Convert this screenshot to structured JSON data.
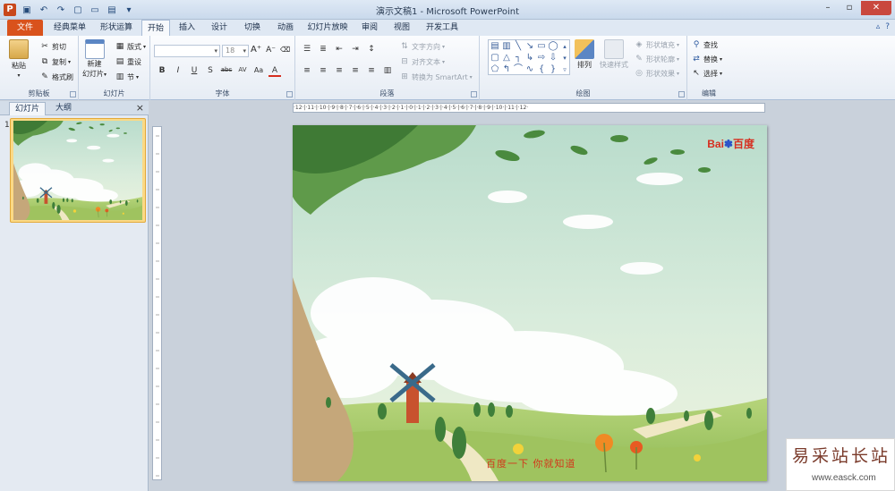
{
  "titlebar": {
    "app_icon": "P",
    "title": "演示文稿1 - Microsoft PowerPoint",
    "qat_icons": [
      "save-icon",
      "undo-icon",
      "redo-icon",
      "new-icon",
      "open-icon",
      "print-icon",
      "more-icon"
    ]
  },
  "tabs": [
    "文件",
    "经典菜单",
    "形状运算",
    "开始",
    "插入",
    "设计",
    "切换",
    "动画",
    "幻灯片放映",
    "审阅",
    "视图",
    "开发工具"
  ],
  "active_tab": "开始",
  "ribbon": {
    "clipboard": {
      "label": "剪贴板",
      "paste": "粘贴",
      "cut": "剪切",
      "copy": "复制",
      "painter": "格式刷"
    },
    "slides": {
      "label": "幻灯片",
      "new_slide_1": "新建",
      "new_slide_2": "幻灯片",
      "layout": "版式",
      "reset": "重设",
      "section": "节"
    },
    "font": {
      "label": "字体",
      "size": "18",
      "bold": "B",
      "italic": "I",
      "underline": "U",
      "shadow": "S",
      "strike": "abc",
      "spacing": "AV",
      "case": "Aa",
      "color": "A"
    },
    "paragraph": {
      "label": "段落",
      "text_direction": "文字方向",
      "align_text": "对齐文本",
      "smartart": "转换为 SmartArt"
    },
    "drawing": {
      "label": "绘图",
      "arrange": "排列",
      "quick_styles": "快速样式",
      "shape_fill": "形状填充",
      "shape_outline": "形状轮廓",
      "shape_effects": "形状效果"
    },
    "editing": {
      "label": "编辑",
      "find": "查找",
      "replace": "替换",
      "select": "选择"
    }
  },
  "leftpanel": {
    "tab_slides": "幻灯片",
    "tab_outline": "大纲",
    "close": "×",
    "slide_number": "1"
  },
  "ruler_text": "·12·|·11·|·10·|·9·|·8·|·7·|·6·|·5·|·4·|·3·|·2·|·1·|·0·|·1·|·2·|·3·|·4·|·5·|·6·|·7·|·8·|·9·|·10·|·11·|·12·",
  "slide": {
    "logo_text": "Bai",
    "logo_cn": "百度",
    "slogan": "百度一下 你就知道"
  },
  "watermark": {
    "cn": "易采站长站",
    "url": "www.easck.com"
  }
}
